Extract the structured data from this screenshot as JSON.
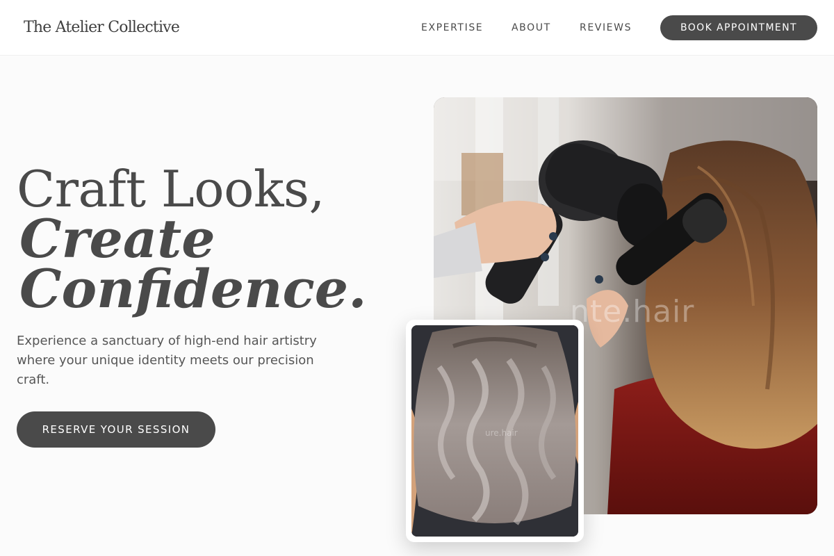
{
  "header": {
    "logo": "The Atelier Collective",
    "nav": [
      {
        "label": "EXPERTISE"
      },
      {
        "label": "ABOUT"
      },
      {
        "label": "REVIEWS"
      }
    ],
    "cta_label": "BOOK APPOINTMENT"
  },
  "hero": {
    "title_line1": "Craft Looks,",
    "title_line2": "Create",
    "title_line3": "Confidence.",
    "subtitle": "Experience a sanctuary of high-end hair artistry where your unique identity meets our precision craft.",
    "cta_label": "RESERVE YOUR SESSION"
  },
  "images": {
    "main_watermark": "nte.hair",
    "secondary_watermark": "ure.hair"
  },
  "colors": {
    "primary": "#4a4a4a",
    "background": "#fbfbfb",
    "button_text": "#ffffff"
  }
}
